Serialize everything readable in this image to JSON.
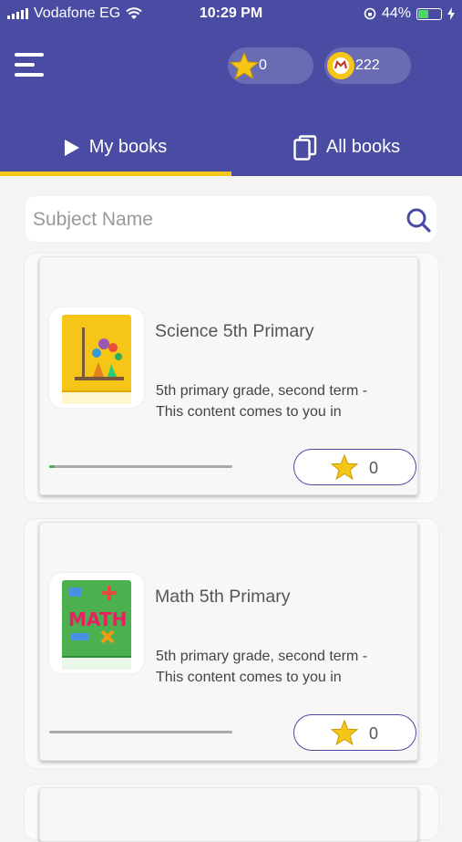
{
  "status_bar": {
    "carrier": "Vodafone EG",
    "time": "10:29 PM",
    "battery": "44%",
    "battery_level": 0.44
  },
  "header": {
    "stars_count": "0",
    "coins_count": "222",
    "tabs": [
      {
        "label": "My books",
        "selected": true
      },
      {
        "label": "All books",
        "selected": false
      }
    ]
  },
  "search": {
    "placeholder": "Subject Name",
    "value": ""
  },
  "books": [
    {
      "title": "Science 5th Primary",
      "description": "5th primary grade, second term  -\nThis content comes to you in",
      "progress": 0.03,
      "rating": "0",
      "cover": "science"
    },
    {
      "title": "Math 5th Primary",
      "description": "5th primary grade, second term  -\nThis content comes to you in",
      "progress": 0.0,
      "rating": "0",
      "cover": "math"
    }
  ],
  "colors": {
    "primary": "#4a4ca3",
    "accent": "#f5c518",
    "progress": "#4caf50"
  },
  "icons": [
    "signal-icon",
    "wifi-icon",
    "lock-rotation-icon",
    "battery-icon",
    "charging-icon",
    "menu-icon",
    "star-icon",
    "coin-icon",
    "play-icon",
    "copy-icon",
    "search-icon"
  ]
}
